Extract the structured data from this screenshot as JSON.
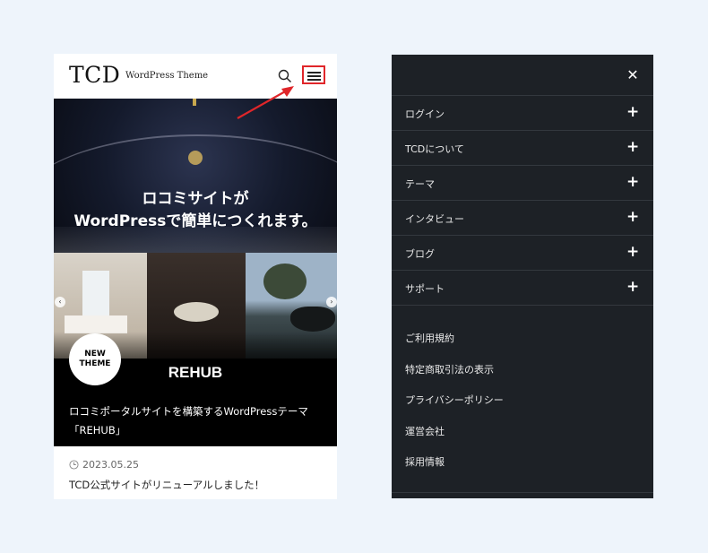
{
  "phone": {
    "logo": "TCD",
    "tagline": "WordPress Theme",
    "hero": {
      "headline_line1": "ロコミサイトが",
      "headline_line2": "WordPressで簡単につくれます。",
      "badge_line1": "NEW",
      "badge_line2": "THEME",
      "product_name": "REHUB"
    },
    "news": {
      "title_line1": "ロコミポータルサイトを構築するWordPressテーマ",
      "title_line2": "「REHUB」",
      "date": "2023.05.25",
      "text": "TCD公式サイトがリニューアルしました！"
    }
  },
  "menu": {
    "close_icon": "✕",
    "items": [
      {
        "label": "ログイン",
        "icon": "+"
      },
      {
        "label": "TCDについて",
        "icon": "+"
      },
      {
        "label": "テーマ",
        "icon": "+"
      },
      {
        "label": "インタビュー",
        "icon": "+"
      },
      {
        "label": "ブログ",
        "icon": "+"
      },
      {
        "label": "サポート",
        "icon": "+"
      }
    ],
    "footer_links": [
      "ご利用規約",
      "特定商取引法の表示",
      "プライバシーポリシー",
      "運営会社",
      "採用情報"
    ]
  },
  "colors": {
    "page_bg": "#eef4fb",
    "menu_bg": "#1d2126",
    "highlight": "#e0262a"
  }
}
